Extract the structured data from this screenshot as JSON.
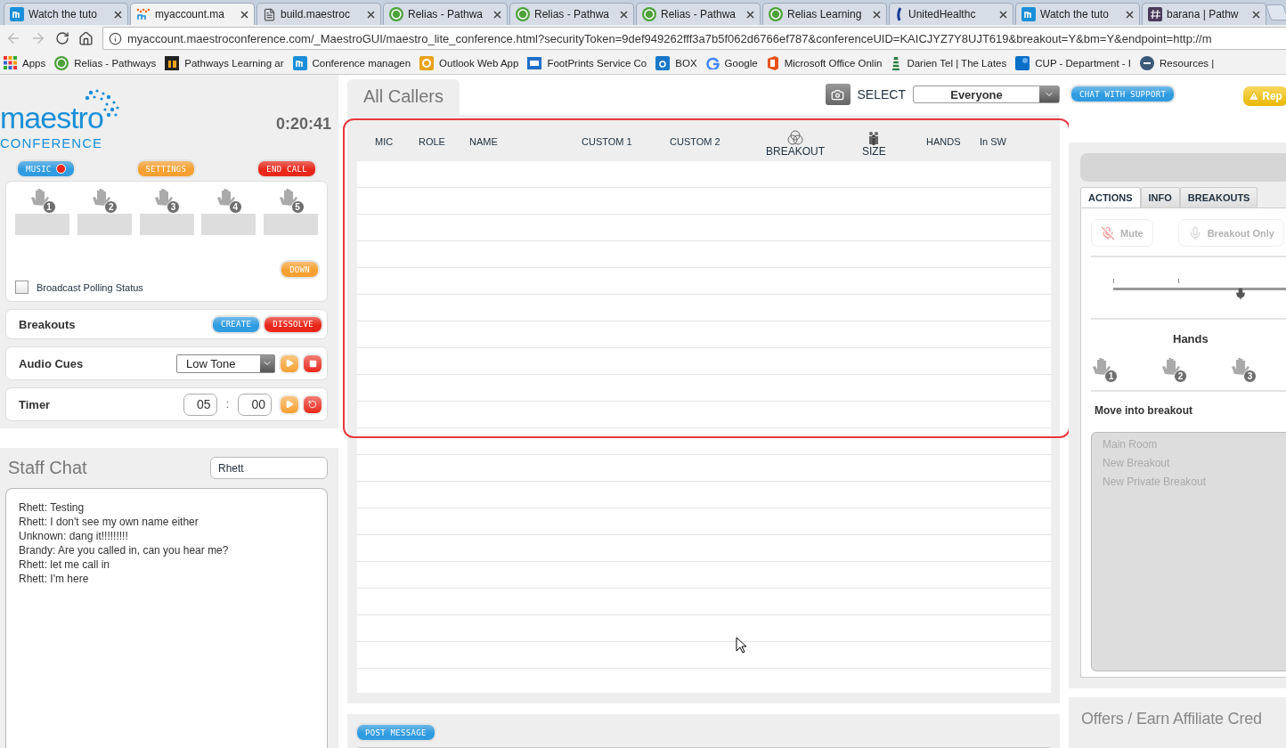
{
  "browser": {
    "tabs": [
      {
        "title": "Watch the tuto",
        "kind": "m",
        "selected": false
      },
      {
        "title": "myaccount.ma",
        "kind": "maestro",
        "selected": true
      },
      {
        "title": "build.maestroc",
        "kind": "doc",
        "selected": false
      },
      {
        "title": "Relias - Pathwa",
        "kind": "r",
        "selected": false
      },
      {
        "title": "Relias - Pathwa",
        "kind": "r",
        "selected": false
      },
      {
        "title": "Relias - Pathwa",
        "kind": "r",
        "selected": false
      },
      {
        "title": "Relias Learning",
        "kind": "r",
        "selected": false
      },
      {
        "title": "UnitedHealthc",
        "kind": "uhc",
        "selected": false
      },
      {
        "title": "Watch the tuto",
        "kind": "m",
        "selected": false
      },
      {
        "title": "barana | Pathw",
        "kind": "hash",
        "selected": false
      }
    ],
    "url": "myaccount.maestroconference.com/_MaestroGUI/maestro_lite_conference.html?securityToken=9def949262fff3a7b5f062d6766ef787&conferenceUID=KAICJYZ7Y8UJT619&breakout=Y&bm=Y&endpoint=http://m",
    "bookmarks": [
      {
        "label": "Apps",
        "kind": "apps"
      },
      {
        "label": "Relias - Pathways",
        "kind": "r"
      },
      {
        "label": "Pathways Learning ar",
        "kind": "in"
      },
      {
        "label": "Conference managen",
        "kind": "m"
      },
      {
        "label": "Outlook Web App",
        "kind": "outlook"
      },
      {
        "label": "FootPrints Service Co",
        "kind": "fp"
      },
      {
        "label": "BOX",
        "kind": "box"
      },
      {
        "label": "Google",
        "kind": "google"
      },
      {
        "label": "Microsoft Office Onlin",
        "kind": "office"
      },
      {
        "label": "Darien Tel | The Lates",
        "kind": "tower"
      },
      {
        "label": "CUP - Department - I",
        "kind": "sp"
      },
      {
        "label": "Resources |",
        "kind": "gtd"
      }
    ]
  },
  "left": {
    "logo": {
      "word": "maestro",
      "sub": "CONFERENCE"
    },
    "clock": "0:20:41",
    "top_buttons": [
      {
        "label": "MUSIC",
        "color": "#2f9be0",
        "indicator": true
      },
      {
        "label": "SETTINGS",
        "color": "#f5a030",
        "indicator": false
      },
      {
        "label": "END CALL",
        "color": "#e8271a",
        "indicator": false
      }
    ],
    "hand_slots": [
      {
        "number": "1"
      },
      {
        "number": "2"
      },
      {
        "number": "3"
      },
      {
        "number": "4"
      },
      {
        "number": "5"
      }
    ],
    "down_button": "DOWN",
    "broadcast": {
      "label": "Broadcast Polling Status",
      "checked": false
    },
    "breakouts": {
      "label": "Breakouts",
      "buttons": [
        {
          "label": "CREATE",
          "color": "#2f9be0"
        },
        {
          "label": "DISSOLVE",
          "color": "#e8271a"
        }
      ]
    },
    "audio_cues": {
      "label": "Audio Cues",
      "value": "Low Tone"
    },
    "timer": {
      "label": "Timer",
      "minutes": "05",
      "separator": ":",
      "seconds": "00"
    },
    "staff_chat": {
      "title": "Staff Chat",
      "name": "Rhett",
      "messages": [
        "Rhett: Testing",
        "Rhett: I don't see my own name either",
        "Unknown: dang it!!!!!!!!!",
        "Brandy: Are you called in, can you hear me?",
        "Rhett: let me call in",
        "Rhett: I'm here"
      ]
    }
  },
  "center": {
    "tab": "All Callers",
    "select_label": "SELECT",
    "select_value": "Everyone",
    "highlighted": true,
    "columns": [
      {
        "label": "MIC",
        "kind": "plain"
      },
      {
        "label": "ROLE",
        "kind": "plain"
      },
      {
        "label": "NAME",
        "kind": "plain"
      },
      {
        "label": "CUSTOM 1",
        "kind": "plain"
      },
      {
        "label": "CUSTOM 2",
        "kind": "plain"
      },
      {
        "label": "BREAKOUT",
        "kind": "circles"
      },
      {
        "label": "SIZE",
        "kind": "people"
      },
      {
        "label": "HANDS",
        "kind": "plain"
      },
      {
        "label": "In SW",
        "kind": "plain"
      }
    ],
    "post_button": "POST MESSAGE"
  },
  "right": {
    "support_button": "CHAT WITH SUPPORT",
    "report_button": "Rep",
    "tabs": [
      {
        "label": "ACTIONS",
        "selected": true
      },
      {
        "label": "INFO",
        "selected": false
      },
      {
        "label": "BREAKOUTS",
        "selected": false
      }
    ],
    "action_buttons": [
      {
        "label": "Mute",
        "kind": "mute",
        "disabled": true
      },
      {
        "label": "Breakout Only",
        "kind": "mic",
        "disabled": true
      }
    ],
    "volume": {
      "level": 0.65
    },
    "hands_title": "Hands",
    "hands": [
      {
        "number": "1"
      },
      {
        "number": "2"
      },
      {
        "number": "3"
      }
    ],
    "move_title": "Move into breakout",
    "breakout_list": [
      {
        "label": "Main Room",
        "disabled": true
      },
      {
        "label": "New Breakout",
        "disabled": true
      },
      {
        "label": "New Private Breakout",
        "disabled": true
      }
    ],
    "offers_title": "Offers / Earn Affiliate Cred"
  }
}
